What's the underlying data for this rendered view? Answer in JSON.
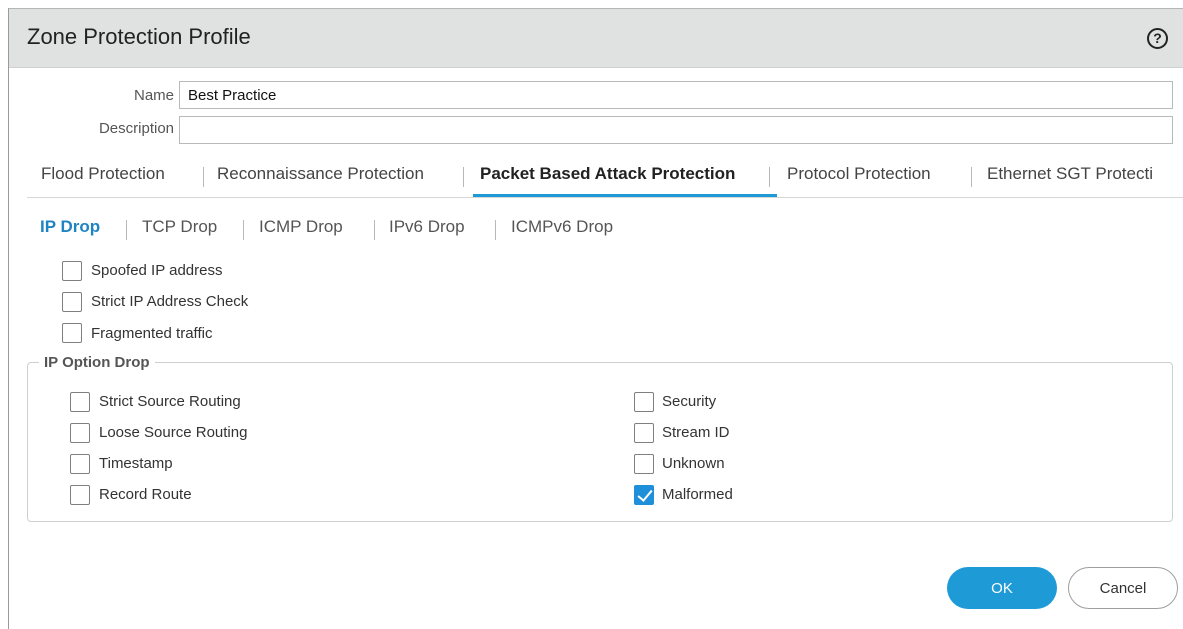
{
  "dialog": {
    "title": "Zone Protection Profile",
    "help_glyph": "?"
  },
  "form": {
    "name_label": "Name",
    "name_value": "Best Practice",
    "description_label": "Description",
    "description_value": ""
  },
  "tabs": [
    {
      "label": "Flood Protection",
      "active": false
    },
    {
      "label": "Reconnaissance Protection",
      "active": false
    },
    {
      "label": "Packet Based Attack Protection",
      "active": true
    },
    {
      "label": "Protocol Protection",
      "active": false
    },
    {
      "label": "Ethernet SGT Protecti",
      "active": false
    }
  ],
  "subtabs": [
    {
      "label": "IP Drop",
      "active": true
    },
    {
      "label": "TCP Drop",
      "active": false
    },
    {
      "label": "ICMP Drop",
      "active": false
    },
    {
      "label": "IPv6 Drop",
      "active": false
    },
    {
      "label": "ICMPv6 Drop",
      "active": false
    }
  ],
  "ip_drop": [
    {
      "label": "Spoofed IP address",
      "checked": false
    },
    {
      "label": "Strict IP Address Check",
      "checked": false
    },
    {
      "label": "Fragmented traffic",
      "checked": false
    }
  ],
  "ip_option_drop": {
    "legend": "IP Option Drop",
    "left": [
      {
        "label": "Strict Source Routing",
        "checked": false
      },
      {
        "label": "Loose Source Routing",
        "checked": false
      },
      {
        "label": "Timestamp",
        "checked": false
      },
      {
        "label": "Record Route",
        "checked": false
      }
    ],
    "right": [
      {
        "label": "Security",
        "checked": false
      },
      {
        "label": "Stream ID",
        "checked": false
      },
      {
        "label": "Unknown",
        "checked": false
      },
      {
        "label": "Malformed",
        "checked": true
      }
    ]
  },
  "buttons": {
    "ok": "OK",
    "cancel": "Cancel"
  },
  "colors": {
    "accent": "#1e9bd7",
    "titlebar": "#e0e2e2"
  }
}
